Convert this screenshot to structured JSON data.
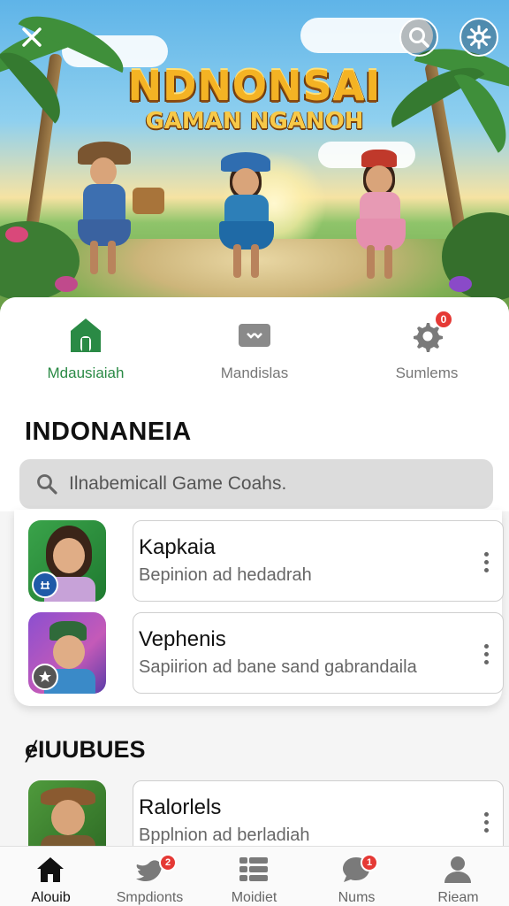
{
  "hero": {
    "title_line1": "NDNONSAI",
    "title_line2": "GAMAN NGANOH",
    "close_label": "close",
    "search_label": "search",
    "settings_label": "settings"
  },
  "tabs": [
    {
      "label": "Mdausiaiah",
      "icon": "home-icon",
      "active": true
    },
    {
      "label": "Mandislas",
      "icon": "controller-icon",
      "active": false
    },
    {
      "label": "Sumlems",
      "icon": "gear-icon",
      "active": false,
      "badge": "0"
    }
  ],
  "section1": {
    "title": "INDONANEIA",
    "search_placeholder": "Ilnabemicall Game Coahs."
  },
  "games": [
    {
      "name": "Kapkaia",
      "desc": "Bepinion ad hedadrah",
      "icon": "coin-icon"
    },
    {
      "name": "Vephenis",
      "desc": "Sapiirion ad bane sand gabrandaila",
      "icon": "star-icon"
    },
    {
      "name": "Ralorlels",
      "desc": "Bpplnion ad berladiah",
      "icon": "coin-icon"
    }
  ],
  "section2": {
    "title": "ɇIUUBUES"
  },
  "bottom_nav": [
    {
      "label": "Alouib",
      "icon": "home-icon",
      "active": true
    },
    {
      "label": "Smpdionts",
      "icon": "chat-bird-icon",
      "badge": "2"
    },
    {
      "label": "Moidiet",
      "icon": "grid-icon"
    },
    {
      "label": "Nums",
      "icon": "message-icon",
      "badge": "1"
    },
    {
      "label": "Rieam",
      "icon": "profile-icon"
    }
  ],
  "colors": {
    "accent_green": "#2a8a45",
    "badge_red": "#e53935",
    "title_gold": "#f4b324"
  }
}
